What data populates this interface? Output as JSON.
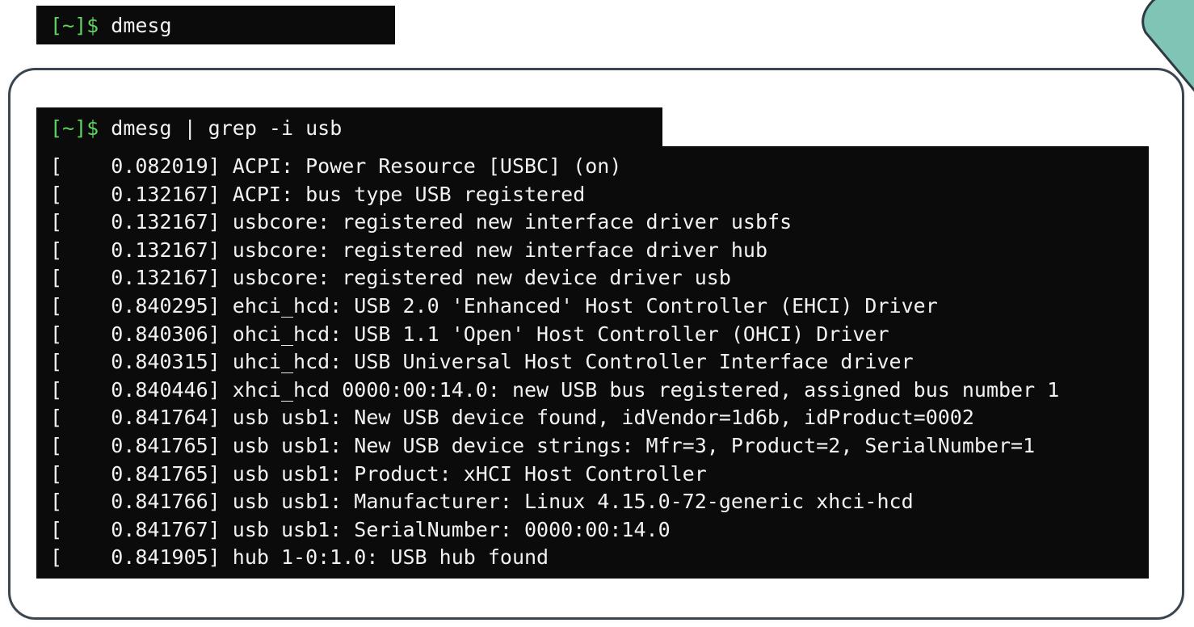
{
  "top_terminal": {
    "prompt": "[~]$",
    "command": " dmesg"
  },
  "main_terminal": {
    "prompt": "[~]$",
    "command": " dmesg | grep -i usb",
    "lines": [
      "[    0.082019] ACPI: Power Resource [USBC] (on)",
      "[    0.132167] ACPI: bus type USB registered",
      "[    0.132167] usbcore: registered new interface driver usbfs",
      "[    0.132167] usbcore: registered new interface driver hub",
      "[    0.132167] usbcore: registered new device driver usb",
      "[    0.840295] ehci_hcd: USB 2.0 'Enhanced' Host Controller (EHCI) Driver",
      "[    0.840306] ohci_hcd: USB 1.1 'Open' Host Controller (OHCI) Driver",
      "[    0.840315] uhci_hcd: USB Universal Host Controller Interface driver",
      "[    0.840446] xhci_hcd 0000:00:14.0: new USB bus registered, assigned bus number 1",
      "[    0.841764] usb usb1: New USB device found, idVendor=1d6b, idProduct=0002",
      "[    0.841765] usb usb1: New USB device strings: Mfr=3, Product=2, SerialNumber=1",
      "[    0.841765] usb usb1: Product: xHCI Host Controller",
      "[    0.841766] usb usb1: Manufacturer: Linux 4.15.0-72-generic xhci-hcd",
      "[    0.841767] usb usb1: SerialNumber: 0000:00:14.0",
      "[    0.841905] hub 1-0:1.0: USB hub found"
    ]
  },
  "colors": {
    "terminal_bg": "#0b0b0b",
    "terminal_text": "#f2f2f2",
    "prompt": "#5fd35f",
    "card_border": "#3b4550",
    "deco_teal": "#7fc4b4",
    "deco_tan": "#c9a572"
  }
}
